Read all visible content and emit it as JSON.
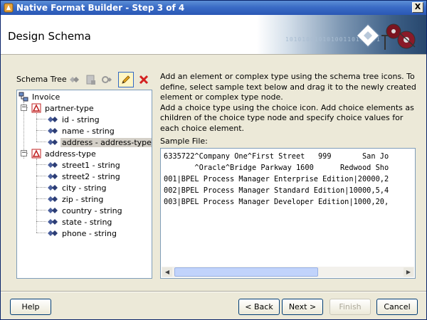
{
  "window": {
    "title": "Native Format Builder - Step 3 of 4",
    "close_label": "X"
  },
  "header": {
    "title": "Design Schema",
    "banner_text": "10101001010100110100101"
  },
  "tree": {
    "label": "Schema Tree",
    "toolbar_icons": [
      "add-element-icon",
      "add-complex-type-icon",
      "add-choice-icon",
      "edit-icon",
      "delete-icon"
    ],
    "nodes": {
      "invoice": "Invoice",
      "partner_type": "partner-type",
      "id": "id - string",
      "name": "name - string",
      "address": "address - address-type",
      "address_type": "address-type",
      "street1": "street1 - string",
      "street2": "street2 - string",
      "city": "city - string",
      "zip": "zip - string",
      "country": "country - string",
      "state": "state - string",
      "phone": "phone - string"
    }
  },
  "instructions": {
    "text": "Add an element or complex type using the schema tree icons. To define, select sample text below and drag it to the newly created element or complex type node.\nAdd a choice type using the choice icon. Add choice elements as children of the choice type node and specify choice values for each choice element."
  },
  "sample": {
    "label": "Sample File:",
    "lines": [
      "6335722^Company One^First Street   999       San Jo",
      "       ^Oracle^Bridge Parkway 1600      Redwood Sho",
      "001|BPEL Process Manager Enterprise Edition|20000,2",
      "002|BPEL Process Manager Standard Edition|10000,5,4",
      "003|BPEL Process Manager Developer Edition|1000,20,"
    ]
  },
  "buttons": {
    "help": "Help",
    "back": "< Back",
    "next": "Next >",
    "finish": "Finish",
    "cancel": "Cancel"
  },
  "colors": {
    "title_bar": "#2a57b5",
    "dialog_bg": "#ece9d8",
    "selection": "#d4d0c8"
  }
}
